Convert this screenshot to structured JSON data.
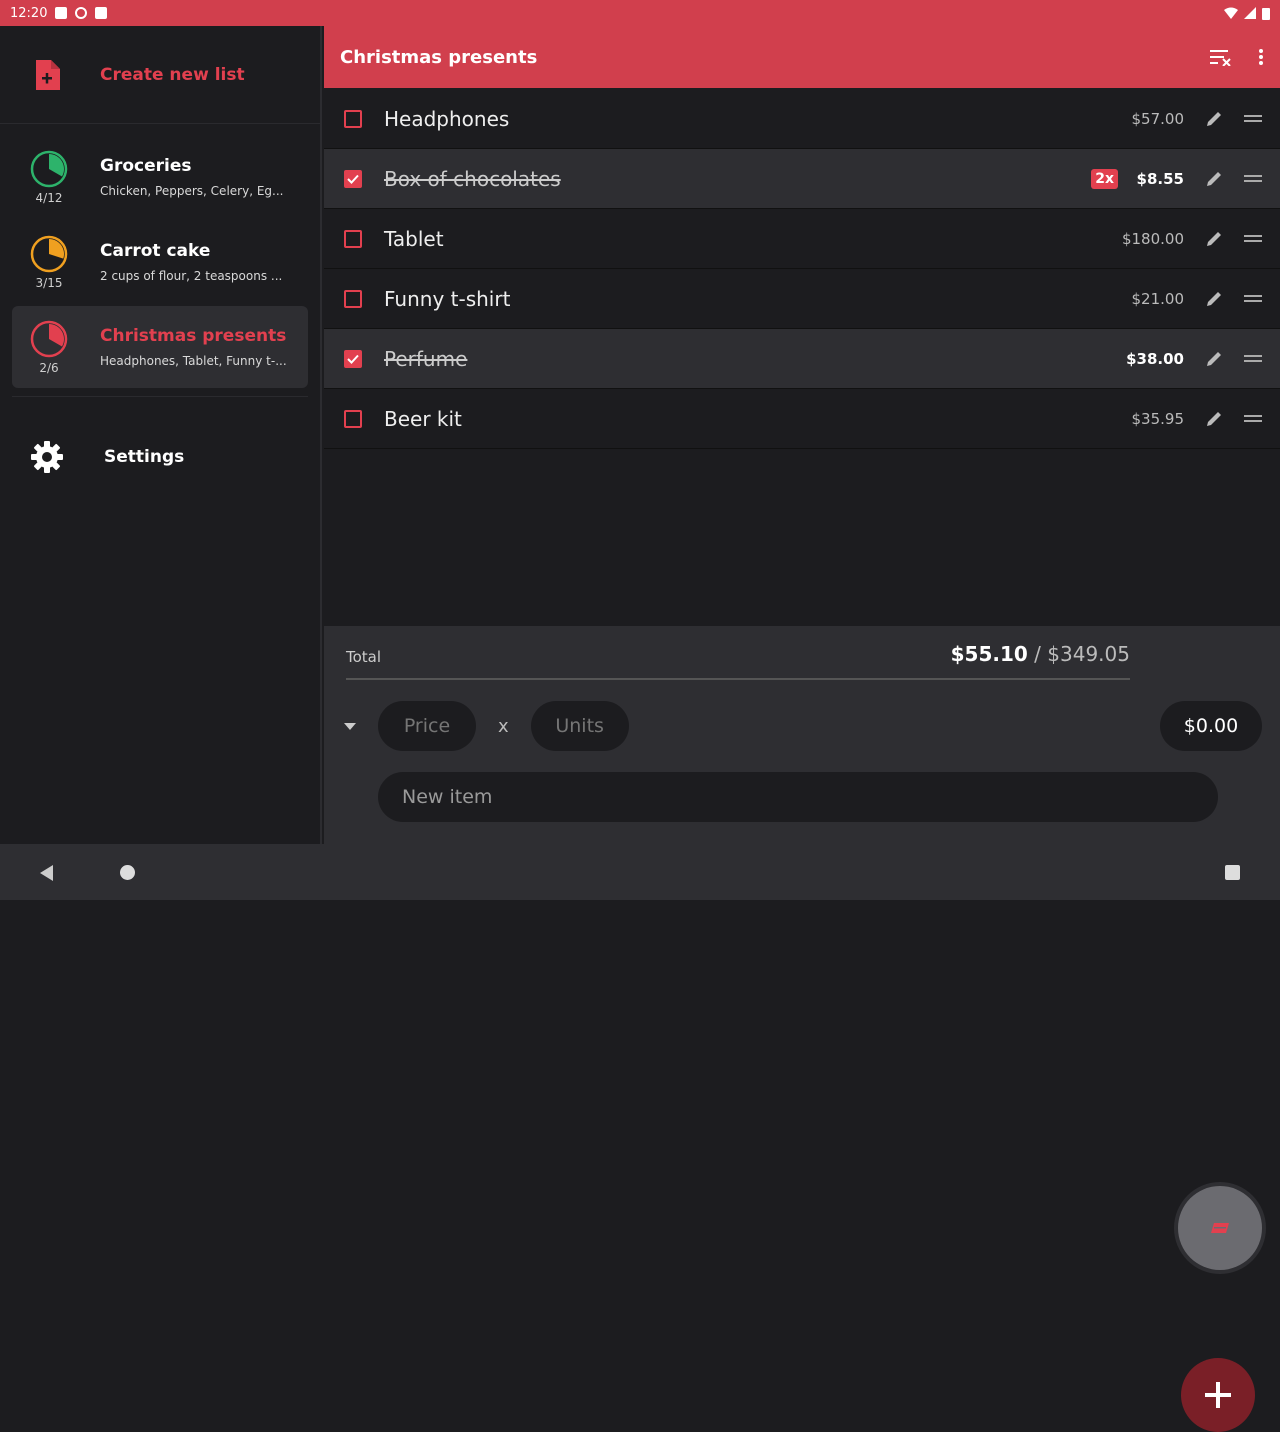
{
  "status_bar": {
    "time": "12:20"
  },
  "drawer": {
    "create_label": "Create new list",
    "lists": [
      {
        "title": "Groceries",
        "count": "4/12",
        "subtitle": "Chicken, Peppers, Celery, Eg...",
        "progress": 0.33,
        "color": "#2db36b"
      },
      {
        "title": "Carrot cake",
        "count": "3/15",
        "subtitle": "2 cups of flour, 2 teaspoons ...",
        "progress": 0.2,
        "color": "#f0a020"
      },
      {
        "title": "Christmas presents",
        "count": "2/6",
        "subtitle": "Headphones, Tablet, Funny t-...",
        "progress": 0.33,
        "color": "#e2404f"
      }
    ],
    "settings_label": "Settings"
  },
  "toolbar": {
    "title": "Christmas presents"
  },
  "items": [
    {
      "name": "Headphones",
      "price": "$57.00",
      "checked": false,
      "qty": ""
    },
    {
      "name": "Box of chocolates",
      "price": "$8.55",
      "checked": true,
      "qty": "2x"
    },
    {
      "name": "Tablet",
      "price": "$180.00",
      "checked": false,
      "qty": ""
    },
    {
      "name": "Funny t-shirt",
      "price": "$21.00",
      "checked": false,
      "qty": ""
    },
    {
      "name": "Perfume",
      "price": "$38.00",
      "checked": true,
      "qty": ""
    },
    {
      "name": "Beer kit",
      "price": "$35.95",
      "checked": false,
      "qty": ""
    }
  ],
  "bottom": {
    "total_label": "Total",
    "total_checked": "$55.10",
    "total_separator": " / ",
    "total_all": "$349.05",
    "price_placeholder": "Price",
    "times": "x",
    "units_placeholder": "Units",
    "line_total": "$0.00",
    "new_item_placeholder": "New item"
  },
  "colors": {
    "accent": "#d13f4d",
    "fab_add": "#7a1f27"
  }
}
